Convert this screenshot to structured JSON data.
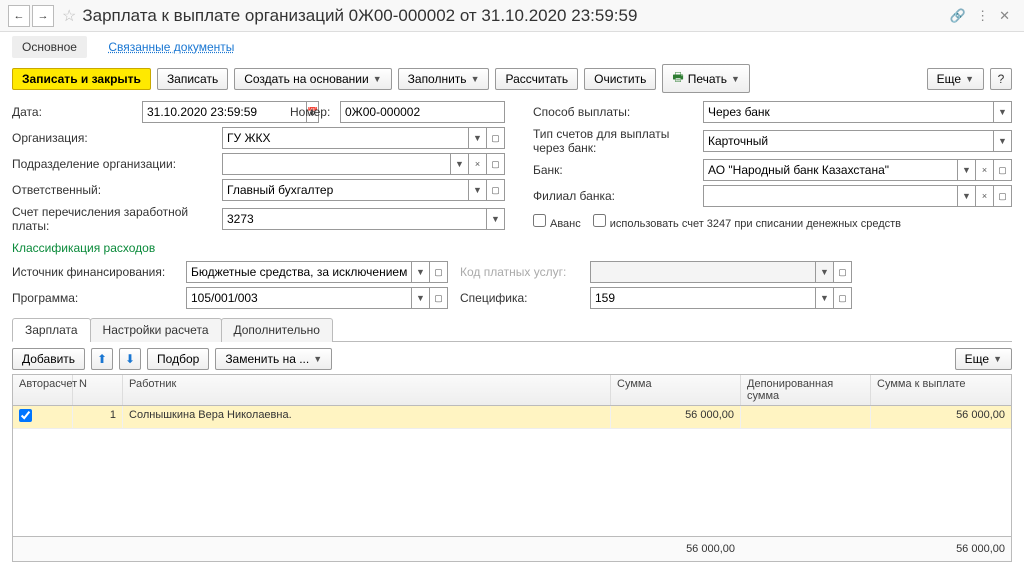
{
  "header": {
    "title": "Зарплата к выплате организаций 0Ж00-000002 от 31.10.2020 23:59:59"
  },
  "docTabs": {
    "main": "Основное",
    "linked": "Связанные документы"
  },
  "toolbar": {
    "save_close": "Записать и закрыть",
    "save": "Записать",
    "create_based": "Создать на основании",
    "fill": "Заполнить",
    "calc": "Рассчитать",
    "clear": "Очистить",
    "print": "Печать",
    "more": "Еще",
    "help": "?"
  },
  "form": {
    "date_lbl": "Дата:",
    "date_val": "31.10.2020 23:59:59",
    "number_lbl": "Номер:",
    "number_val": "0Ж00-000002",
    "org_lbl": "Организация:",
    "org_val": "ГУ ЖКХ",
    "dept_lbl": "Подразделение организации:",
    "dept_val": "",
    "resp_lbl": "Ответственный:",
    "resp_val": "Главный бухгалтер",
    "acct_lbl": "Счет перечисления заработной платы:",
    "acct_val": "3273",
    "paymethod_lbl": "Способ выплаты:",
    "paymethod_val": "Через банк",
    "accttype_lbl": "Тип счетов для выплаты через банк:",
    "accttype_val": "Карточный",
    "bank_lbl": "Банк:",
    "bank_val": "АО \"Народный банк Казахстана\"",
    "branch_lbl": "Филиал банка:",
    "branch_val": "",
    "advance_lbl": "Аванс",
    "use3247_lbl": "использовать счет 3247 при списании денежных средств"
  },
  "classification": {
    "title": "Классификация расходов",
    "source_lbl": "Источник финансирования:",
    "source_val": "Бюджетные средства, за исключением средст",
    "program_lbl": "Программа:",
    "program_val": "105/001/003",
    "paidcode_lbl": "Код платных услуг:",
    "paidcode_val": "",
    "spec_lbl": "Специфика:",
    "spec_val": "159"
  },
  "tabs": {
    "salary": "Зарплата",
    "settings": "Настройки расчета",
    "extra": "Дополнительно"
  },
  "tableToolbar": {
    "add": "Добавить",
    "select": "Подбор",
    "replace": "Заменить на ...",
    "more": "Еще"
  },
  "table": {
    "headers": {
      "auto": "Авторасчет",
      "n": "N",
      "worker": "Работник",
      "sum": "Сумма",
      "dep": "Депонированная сумма",
      "pay": "Сумма к выплате"
    },
    "rows": [
      {
        "auto": true,
        "n": "1",
        "worker": "Солнышкина Вера Николаевна.",
        "sum": "56 000,00",
        "dep": "",
        "pay": "56 000,00"
      }
    ],
    "totals": {
      "sum": "56 000,00",
      "dep": "",
      "pay": "56 000,00"
    }
  }
}
